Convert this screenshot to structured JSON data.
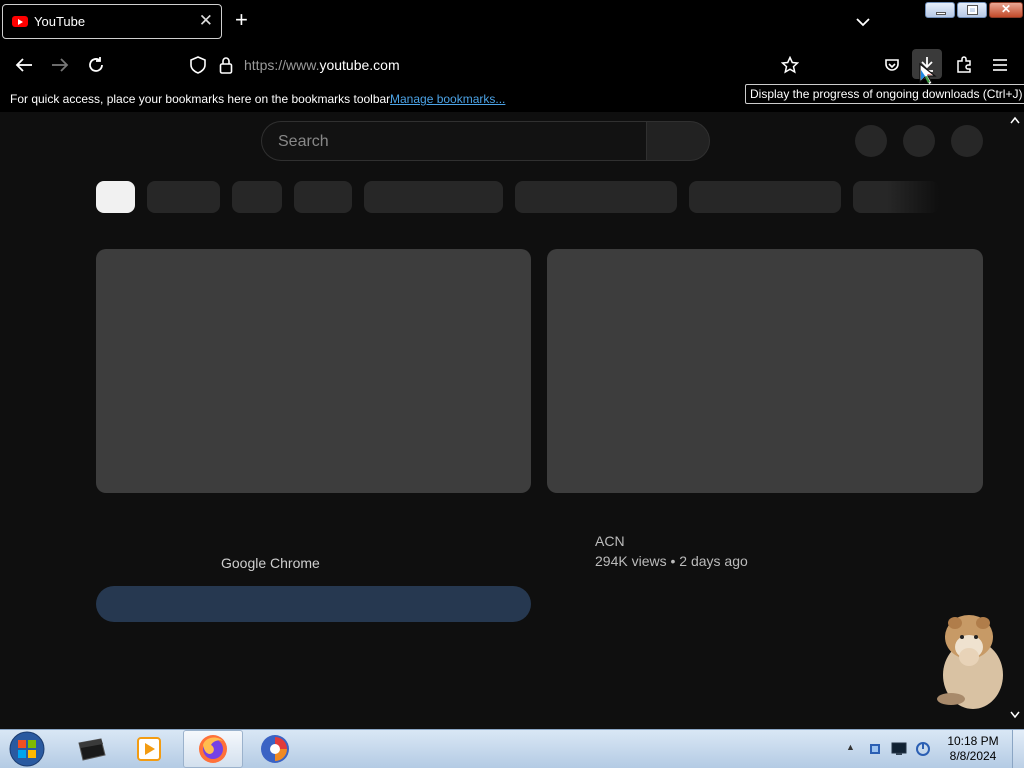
{
  "browser": {
    "tab_title": "YouTube",
    "url_prefix": "https://www.",
    "url_host": "youtube.com",
    "bookmarks_text": "For quick access, place your bookmarks here on the bookmarks toolbar.",
    "bookmarks_link": "Manage bookmarks...",
    "tooltip": "Display the progress of ongoing downloads (Ctrl+J)"
  },
  "youtube": {
    "search_placeholder": "Search",
    "video1_channel": "Google Chrome",
    "video2_channel": "ACN",
    "video2_meta": "294K views • 2 days ago"
  },
  "taskbar": {
    "time": "10:18 PM",
    "date": "8/8/2024"
  },
  "colors": {
    "page_bg": "#0f0f0f",
    "skeleton": "#3d3d3d",
    "chip": "#272727",
    "link": "#4ca3e6"
  }
}
